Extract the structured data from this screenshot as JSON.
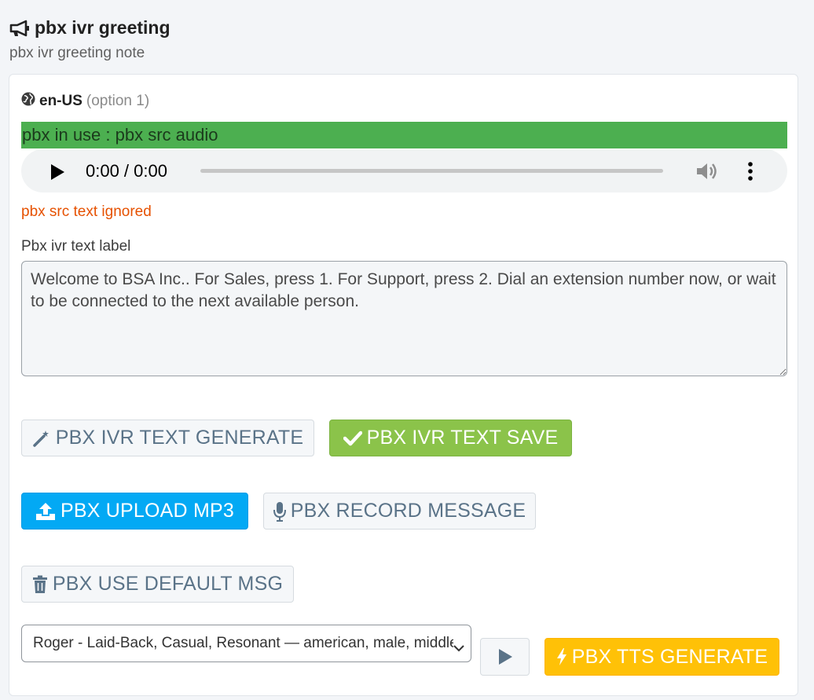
{
  "header": {
    "icon": "megaphone-icon",
    "title": "pbx ivr greeting",
    "note": "pbx ivr greeting note"
  },
  "language": {
    "icon": "globe-icon",
    "code": "en-US",
    "option": "(option 1)"
  },
  "status": {
    "text": "pbx in use : pbx src audio",
    "color": "#4caf50"
  },
  "audio_player": {
    "time": "0:00 / 0:00",
    "progress": 0
  },
  "warning": {
    "text": "pbx src text ignored",
    "color": "#e65100"
  },
  "ivr_text": {
    "label": "Pbx ivr text label",
    "value": "Welcome to BSA Inc.. For Sales, press 1. For Support, press 2. Dial an extension number now, or wait to be connected to the next available person."
  },
  "buttons": {
    "generate": {
      "label": "PBX IVR TEXT GENERATE",
      "icon": "magic-wand-icon"
    },
    "save": {
      "label": "PBX IVR TEXT SAVE",
      "icon": "check-icon",
      "color": "#8bc34a"
    },
    "upload": {
      "label": "PBX UPLOAD MP3",
      "icon": "upload-icon",
      "color": "#03a9f4"
    },
    "record": {
      "label": "PBX RECORD MESSAGE",
      "icon": "microphone-icon"
    },
    "default_msg": {
      "label": "PBX USE DEFAULT MSG",
      "icon": "trash-icon"
    },
    "preview": {
      "icon": "play-icon"
    },
    "tts": {
      "label": "PBX TTS GENERATE",
      "icon": "bolt-icon",
      "color": "#ffc107"
    }
  },
  "voice_select": {
    "selected": "Roger - Laid-Back, Casual, Resonant — american, male, middle-aged"
  }
}
